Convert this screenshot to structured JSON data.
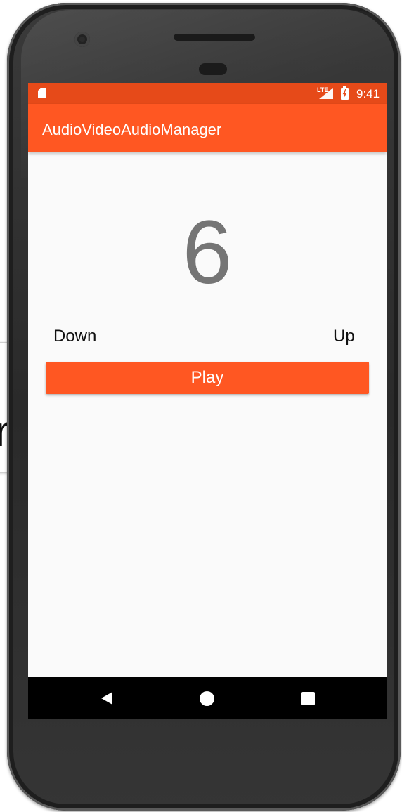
{
  "background_window": {
    "partial_text": "r"
  },
  "status_bar": {
    "network_label": "LTE",
    "time": "9:41"
  },
  "app_bar": {
    "title": "AudioVideoAudioManager"
  },
  "main": {
    "volume_value": "6",
    "down_label": "Down",
    "up_label": "Up",
    "play_label": "Play"
  },
  "colors": {
    "primary": "#ff5722",
    "primary_dark": "#e64a19",
    "volume_text": "#757575",
    "screen_background": "#fafafa"
  },
  "icons": {
    "status_left": "sd-card-icon",
    "status_signal": "signal-icon",
    "status_battery": "battery-charging-icon",
    "nav_back": "back-icon",
    "nav_home": "home-icon",
    "nav_recents": "recents-icon"
  }
}
